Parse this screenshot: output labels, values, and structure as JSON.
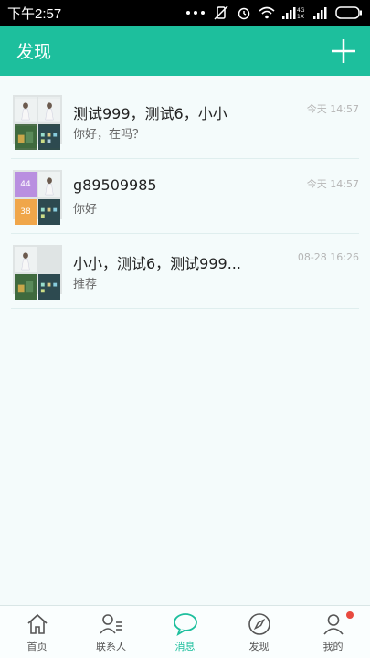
{
  "status_bar": {
    "time": "下午2:57"
  },
  "header": {
    "title": "发现"
  },
  "conversations": [
    {
      "name": "测试999，测试6，小小",
      "last_message": "你好，在吗？",
      "time": "今天  14:57"
    },
    {
      "name": "g89509985",
      "last_message": "你好",
      "time": "今天  14:57",
      "badges": [
        "44",
        "38"
      ]
    },
    {
      "name": "小小，测试6，测试999...",
      "last_message": "推荐",
      "time": "08-28 16:26"
    }
  ],
  "tabs": [
    {
      "label": "首页",
      "icon": "home-icon",
      "active": false
    },
    {
      "label": "联系人",
      "icon": "contacts-icon",
      "active": false
    },
    {
      "label": "消息",
      "icon": "message-icon",
      "active": true
    },
    {
      "label": "发现",
      "icon": "compass-icon",
      "active": false
    },
    {
      "label": "我的",
      "icon": "profile-icon",
      "active": false
    }
  ],
  "colors": {
    "accent": "#1dbf9d",
    "badge_dot": "#e84a3f",
    "status_bar": "#000000"
  }
}
